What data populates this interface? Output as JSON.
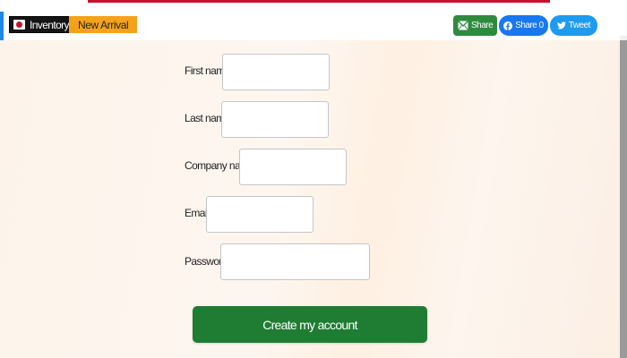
{
  "header": {
    "inventory_label": "Inventory",
    "new_arrival_label": "New Arrival"
  },
  "share": {
    "email_label": "Share",
    "facebook_label": "Share 0",
    "twitter_label": "Tweet"
  },
  "form": {
    "fields": [
      {
        "label": "First name",
        "value": ""
      },
      {
        "label": "Last name",
        "value": ""
      },
      {
        "label": "Company name",
        "value": ""
      },
      {
        "label": "Email",
        "value": ""
      },
      {
        "label": "Password",
        "value": ""
      }
    ],
    "submit_label": "Create my account"
  },
  "colors": {
    "accent_red": "#c8102e",
    "new_arrival": "#f5a21b",
    "submit_green": "#1e7d32",
    "facebook_blue": "#1877f2",
    "twitter_blue": "#1d9bf0"
  }
}
